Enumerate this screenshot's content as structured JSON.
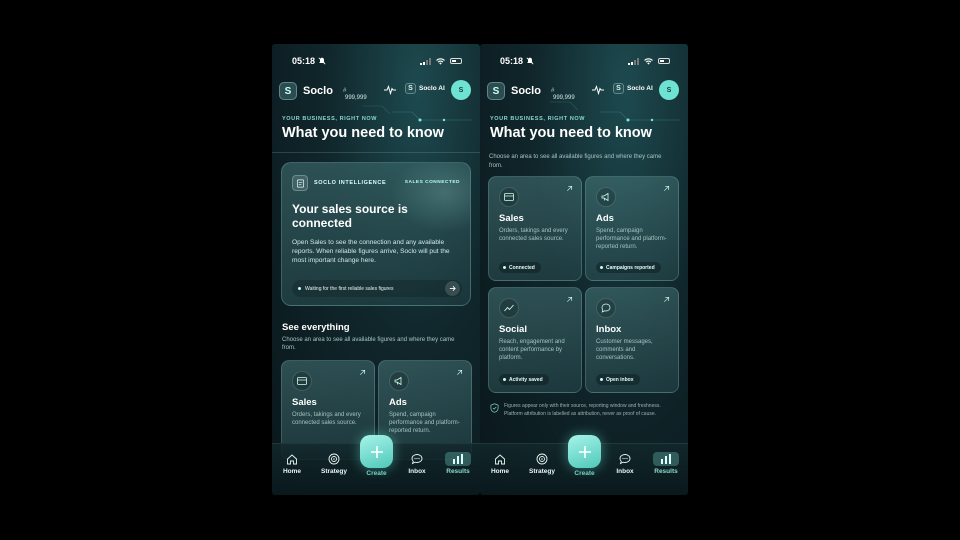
{
  "status_bar": {
    "time": "05:18"
  },
  "header": {
    "brand": "Soclo",
    "logo_letter": "S",
    "hash": "#",
    "count": "999,999",
    "ai_label": "Soclo AI",
    "avatar": "S"
  },
  "hero": {
    "eyebrow": "YOUR BUSINESS, RIGHT NOW",
    "title": "What you need to know"
  },
  "intelligence_card": {
    "label": "SOCLO INTELLIGENCE",
    "tag": "SALES CONNECTED",
    "title": "Your sales source is connected",
    "body": "Open Sales to see the connection and any available reports. When reliable figures arrive, Soclo will put the most important change here.",
    "status": "Waiting for the first reliable sales figures"
  },
  "see_everything": {
    "title": "See everything",
    "subtitle": "Choose an area to see all available figures and where they came from."
  },
  "areas": [
    {
      "title": "Sales",
      "desc": "Orders, takings and every connected sales source.",
      "badge": "Connected",
      "icon": "card-icon"
    },
    {
      "title": "Ads",
      "desc": "Spend, campaign performance and platform-reported return.",
      "badge": "Campaigns reported",
      "icon": "megaphone-icon"
    },
    {
      "title": "Social",
      "desc": "Reach, engagement and content performance by platform.",
      "badge": "Activity saved",
      "icon": "trend-icon"
    },
    {
      "title": "Inbox",
      "desc": "Customer messages, comments and conversations.",
      "badge": "Open inbox",
      "icon": "chat-icon"
    }
  ],
  "footnote": "Figures appear only with their source, reporting window and freshness. Platform attribution is labelled as attribution, never as proof of cause.",
  "tabbar": {
    "home": "Home",
    "strategy": "Strategy",
    "create": "Create",
    "inbox": "Inbox",
    "results": "Results"
  }
}
